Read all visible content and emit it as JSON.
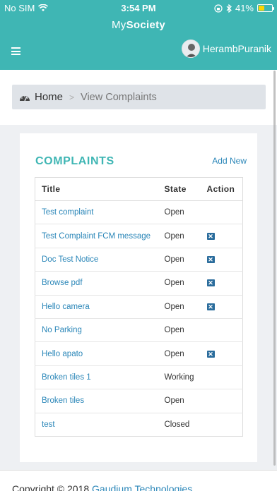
{
  "status_bar": {
    "carrier": "No SIM",
    "time": "3:54 PM",
    "battery": "41%"
  },
  "header": {
    "app_title_prefix": "My",
    "app_title_bold": "Society",
    "username": "HerambPuranik"
  },
  "breadcrumb": {
    "home": "Home",
    "separator": ">",
    "current": "View Complaints"
  },
  "complaints": {
    "heading": "COMPLAINTS",
    "add_new": "Add New",
    "columns": [
      "Title",
      "State",
      "Action"
    ],
    "rows": [
      {
        "title": "Test complaint",
        "state": "Open",
        "delete": false
      },
      {
        "title": "Test Complaint FCM message",
        "state": "Open",
        "delete": true
      },
      {
        "title": "Doc Test Notice",
        "state": "Open",
        "delete": true
      },
      {
        "title": "Browse pdf",
        "state": "Open",
        "delete": true
      },
      {
        "title": "Hello camera",
        "state": "Open",
        "delete": true
      },
      {
        "title": "No Parking",
        "state": "Open",
        "delete": false
      },
      {
        "title": "Hello apato",
        "state": "Open",
        "delete": true
      },
      {
        "title": "Broken tiles 1",
        "state": "Working",
        "delete": false
      },
      {
        "title": "Broken tiles",
        "state": "Open",
        "delete": false
      },
      {
        "title": "test",
        "state": "Closed",
        "delete": false
      }
    ],
    "delete_icon_glyph": "✕"
  },
  "footer": {
    "prefix": "Copyright © 2018 ",
    "company": "Gaudium Technologies"
  },
  "colors": {
    "primary": "#3fb6b4",
    "link": "#2a86b8",
    "delete": "#2a6c9c"
  }
}
